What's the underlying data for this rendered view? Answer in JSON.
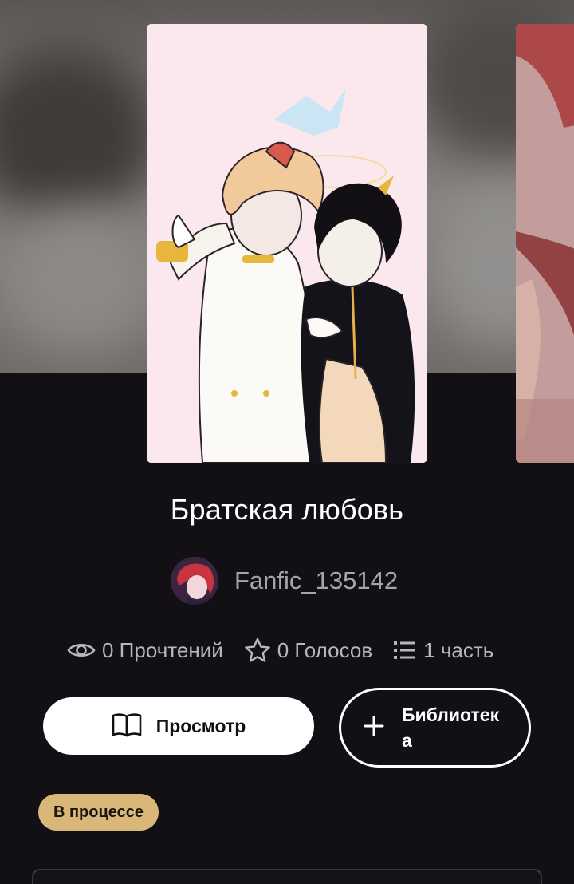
{
  "story": {
    "title": "Братская любовь",
    "author": "Fanfic_135142",
    "status_badge": "В процессе"
  },
  "stats": {
    "reads": "0 Прочтений",
    "votes": "0 Голосов",
    "parts": "1 часть"
  },
  "actions": {
    "view_label": "Просмотр",
    "library_label": "Библиотека"
  },
  "icons": {
    "reads": "eye-icon",
    "votes": "star-icon",
    "parts": "list-icon",
    "view": "book-icon",
    "library": "plus-icon"
  },
  "colors": {
    "background": "#121014",
    "badge": "#d9b778",
    "muted_text": "#a7a5aa"
  }
}
